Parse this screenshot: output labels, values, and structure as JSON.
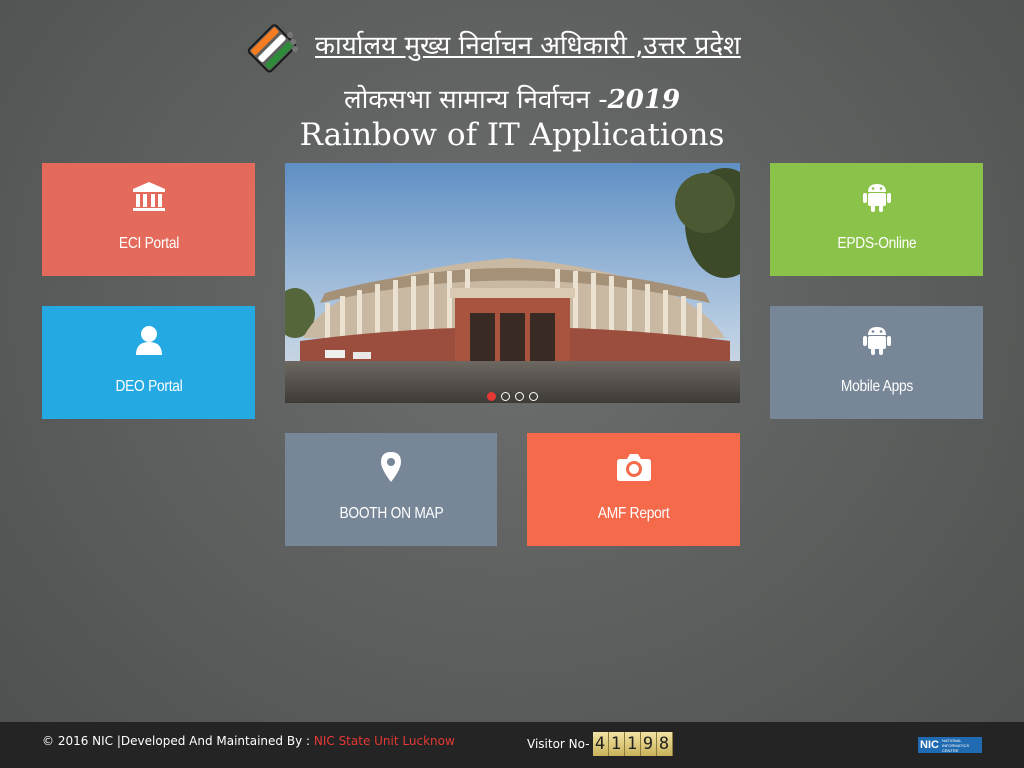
{
  "header": {
    "org_title": "कार्यालय मुख्य निर्वाचन अधिकारी ,उत्तर प्रदेश",
    "election_title": "लोकसभा सामान्य निर्वाचन -",
    "election_year": "2019",
    "main_title": "Rainbow of IT Applications",
    "logo_icon": "election-logo-icon"
  },
  "tiles": {
    "eci": {
      "label": "ECI Portal",
      "icon": "bank-icon",
      "color": "#e46b5b"
    },
    "deo": {
      "label": "DEO Portal",
      "icon": "user-icon",
      "color": "#24a9e2"
    },
    "epds": {
      "label": "EPDS-Online",
      "icon": "android-icon",
      "color": "#8bc249"
    },
    "mobile": {
      "label": "Mobile Apps",
      "icon": "android-icon",
      "color": "#778798"
    },
    "booth": {
      "label": "BOOTH ON MAP",
      "icon": "map-pin-icon",
      "color": "#778798"
    },
    "amf": {
      "label": "AMF Report",
      "icon": "camera-icon",
      "color": "#f56a4b"
    }
  },
  "carousel": {
    "slide_count": 4,
    "active_index": 0,
    "active_color": "#e53935"
  },
  "footer": {
    "copyright": "© 2016 NIC |Developed And Maintained By : ",
    "developer_link": "NIC State Unit Lucknow",
    "visitor_label": "Visitor No-",
    "visitor_digits": [
      "4",
      "1",
      "1",
      "9",
      "8"
    ],
    "nic_logo_text": "NIC",
    "nic_logo_subtext": "NATIONAL INFORMATICS CENTRE"
  }
}
